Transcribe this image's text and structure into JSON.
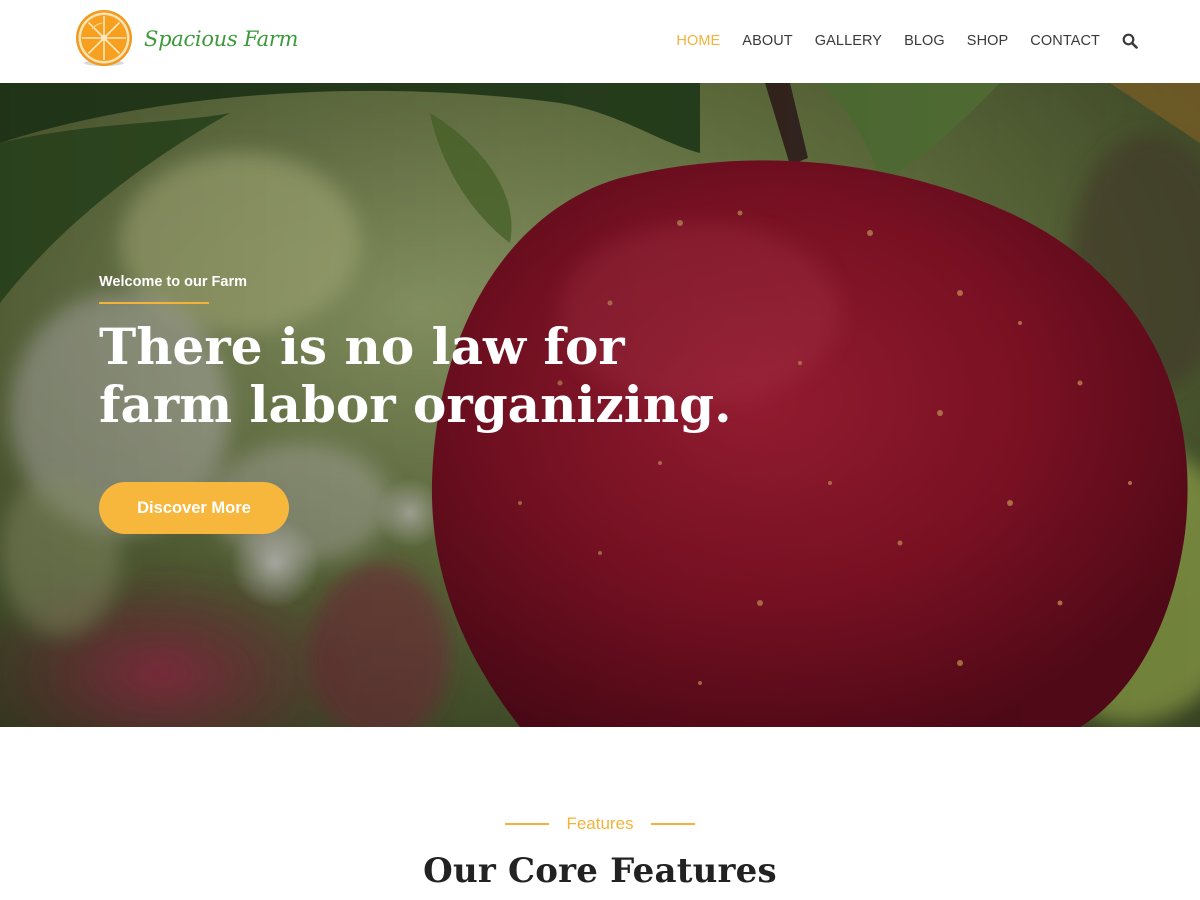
{
  "brand": {
    "name": "Spacious Farm",
    "logo_icon": "orange-slice-icon",
    "name_color": "#3c9a3a"
  },
  "nav": {
    "items": [
      {
        "label": "HOME",
        "active": true
      },
      {
        "label": "ABOUT",
        "active": false
      },
      {
        "label": "GALLERY",
        "active": false
      },
      {
        "label": "BLOG",
        "active": false
      },
      {
        "label": "SHOP",
        "active": false
      },
      {
        "label": "CONTACT",
        "active": false
      }
    ],
    "search_icon": "search-icon",
    "active_color": "#f3b339"
  },
  "hero": {
    "kicker": "Welcome to our Farm",
    "title_line1": "There is no law for",
    "title_line2": "farm labor organizing.",
    "cta_label": "Discover More",
    "cta_color": "#f6b73c",
    "background_image": "red-apple-on-branch"
  },
  "features": {
    "kicker": "Features",
    "title": "Our Core Features"
  },
  "colors": {
    "accent": "#f3b339",
    "heading": "#222222",
    "nav_text": "#3a3a3a"
  }
}
